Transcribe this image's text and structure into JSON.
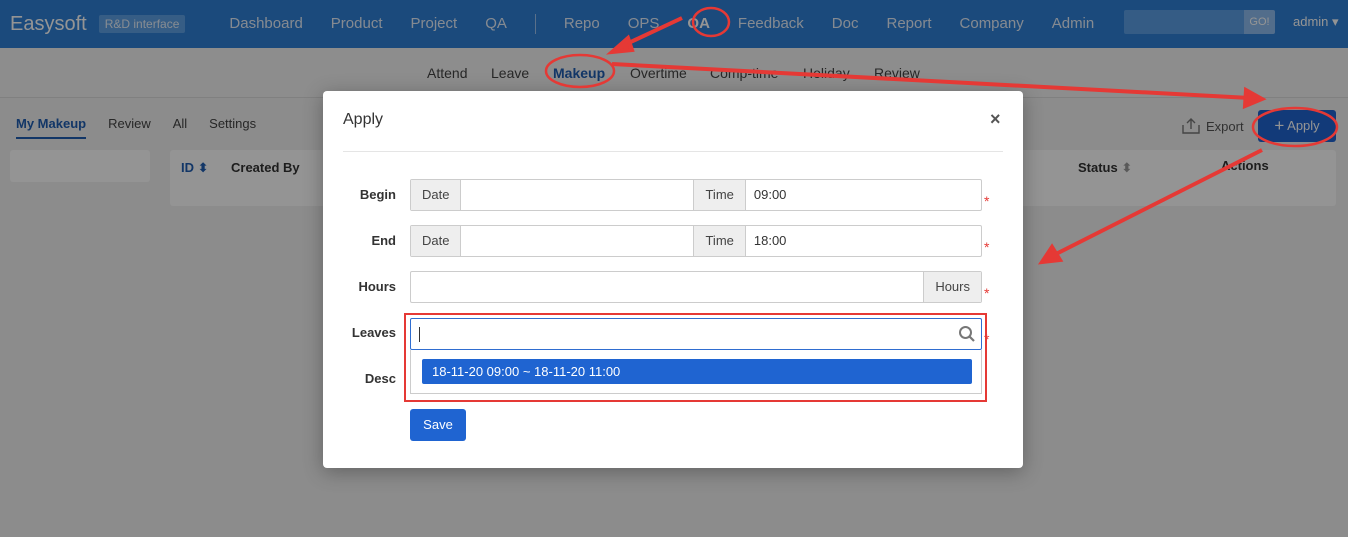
{
  "topbar": {
    "brand": "Easysoft",
    "tag": "R&D interface",
    "nav": [
      "Dashboard",
      "Product",
      "Project",
      "QA",
      "Repo",
      "OPS",
      "OA",
      "Feedback",
      "Doc",
      "Report",
      "Company",
      "Admin"
    ],
    "search_button": "GO!",
    "user": "admin"
  },
  "subnav": [
    "Attend",
    "Leave",
    "Makeup",
    "Overtime",
    "Comp-time",
    "Holiday",
    "Review"
  ],
  "page": {
    "tabs": [
      "My Makeup",
      "Review",
      "All",
      "Settings"
    ],
    "columns": {
      "id": "ID",
      "created_by": "Created By",
      "status": "Status",
      "actions": "Actions"
    },
    "export_label": "Export",
    "apply_label": "Apply"
  },
  "modal": {
    "title": "Apply",
    "close": "×",
    "begin": {
      "label": "Begin",
      "date_addon": "Date",
      "date_value": "",
      "time_addon": "Time",
      "time_value": "09:00"
    },
    "end": {
      "label": "End",
      "date_addon": "Date",
      "date_value": "",
      "time_addon": "Time",
      "time_value": "18:00"
    },
    "hours": {
      "label": "Hours",
      "value": "",
      "addon": "Hours"
    },
    "leaves": {
      "label": "Leaves",
      "value": "",
      "option": "18-11-20 09:00 ~ 18-11-20 11:00"
    },
    "desc": {
      "label": "Desc"
    },
    "required_mark": "*",
    "save_label": "Save"
  },
  "colors": {
    "primary": "#1f64d1",
    "topbar": "#2f80d6",
    "annotation": "#e53935"
  }
}
